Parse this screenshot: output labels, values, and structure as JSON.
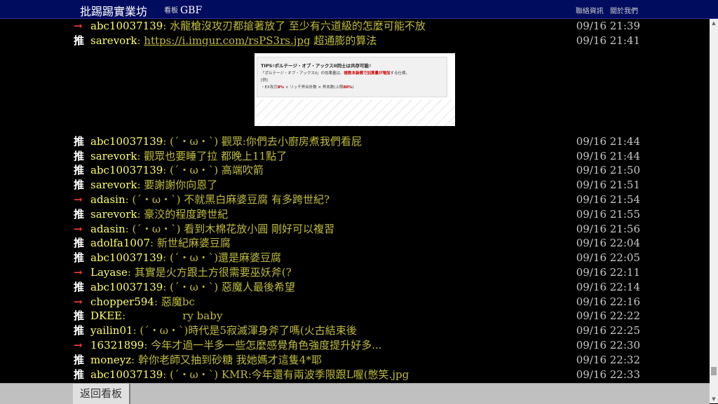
{
  "header": {
    "brand": "批踢踢實業坊",
    "board_label": "看板",
    "board_name": "GBF",
    "links": [
      "聯絡資訊",
      "關於我們"
    ]
  },
  "pushes": [
    {
      "tag": "→",
      "user": "abc10037139",
      "text": "水龍槍沒攻刃都搶著放了 至少有六道級的怎麼可能不放",
      "time": "09/16 21:39"
    },
    {
      "tag": "推",
      "user": "sarevork",
      "link": "https://i.imgur.com/rsPS3rs.jpg",
      "text": "超通膨的算法",
      "time": "09/16 21:41"
    },
    {
      "tag": "推",
      "user": "abc10037139",
      "text": "(´・ω・`) 觀眾:你們去小廚房煮我們看屁",
      "time": "09/16 21:44"
    },
    {
      "tag": "推",
      "user": "sarevork",
      "text": "觀眾也要睡了拉 都晚上11點了",
      "time": "09/16 21:44"
    },
    {
      "tag": "推",
      "user": "abc10037139",
      "text": "(´・ω・`) 高端吹箭",
      "time": "09/16 21:50"
    },
    {
      "tag": "推",
      "user": "sarevork",
      "text": "要謝謝你向恩了",
      "time": "09/16 21:51"
    },
    {
      "tag": "→",
      "user": "adasin",
      "text": "(´・ω・`) 不就黑白麻婆豆腐 有多跨世紀?",
      "time": "09/16 21:54"
    },
    {
      "tag": "推",
      "user": "sarevork",
      "text": "豪洨的程度跨世紀",
      "time": "09/16 21:55"
    },
    {
      "tag": "→",
      "user": "adasin",
      "text": "(´・ω・`) 看到木棉花放小圓 剛好可以複習",
      "time": "09/16 21:56"
    },
    {
      "tag": "推",
      "user": "adolfa1007",
      "text": "新世紀麻婆豆腐",
      "time": "09/16 22:04"
    },
    {
      "tag": "推",
      "user": "abc10037139",
      "text": "(´・ω・`)還是麻婆豆腐",
      "time": "09/16 22:05"
    },
    {
      "tag": "→",
      "user": "Layase",
      "text": "其實是火方跟土方很需要巫妖斧(?",
      "time": "09/16 22:11"
    },
    {
      "tag": "推",
      "user": "abc10037139",
      "text": "(´・ω・`) 惡魔人最後希望",
      "time": "09/16 22:14"
    },
    {
      "tag": "→",
      "user": "chopper594",
      "text": "惡魔bc",
      "time": "09/16 22:16"
    },
    {
      "tag": "推",
      "user": "DKEE",
      "text": "                ry baby",
      "time": "09/16 22:22"
    },
    {
      "tag": "推",
      "user": "yailin01",
      "text": "(´・ω・`)時代是5寂滅渾身斧了嗎(火古結束後",
      "time": "09/16 22:25"
    },
    {
      "tag": "→",
      "user": "16321899",
      "text": "今年才過一半多一些怎麼感覺角色強度提升好多...",
      "time": "09/16 22:30"
    },
    {
      "tag": "推",
      "user": "moneyz",
      "text": "幹你老師又抽到砂糖 我她媽才這隻4*耶",
      "time": "09/16 22:32"
    },
    {
      "tag": "推",
      "user": "abc10037139",
      "text": "(´・ω・`) KMR:今年還有兩波季限跟L喔(憋笑.jpg",
      "time": "09/16 22:33"
    }
  ],
  "embedded_image": {
    "title": "TIPS♯ポルテージ・オブ・アックスII同士は共存可能♯",
    "line1_prefix": "「ポルテージ・オブ・アックスII」の効果量は、",
    "line1_highlight": "複数本装備で加算量が増加",
    "line1_suffix": "する仕様。",
    "line2": "[例]",
    "line3_prefix": "・EX攻刃",
    "line3_hl1": "8%",
    "line3_mid": " × リッチ斧合計数 × 斧本数(上限",
    "line3_hl2": "80%",
    "line3_suffix": ")"
  },
  "footer": {
    "back_label": "返回看板"
  },
  "scrollbar": {
    "up_arrow": "▲",
    "down_arrow": "▼"
  }
}
